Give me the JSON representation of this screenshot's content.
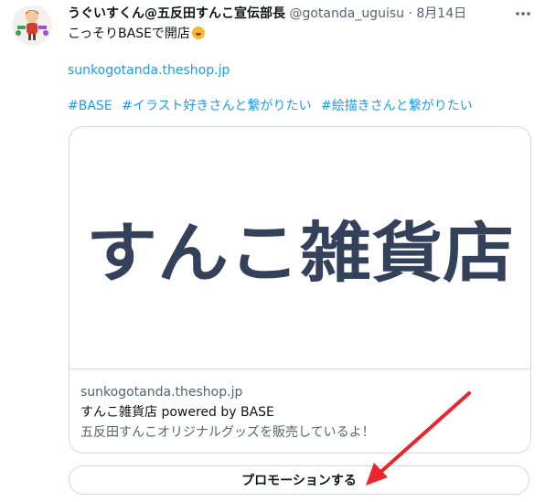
{
  "tweet": {
    "author_name": "うぐいすくん@五反田すんこ宣伝部長",
    "handle": "@gotanda_uguisu",
    "separator": "·",
    "date": "8月14日",
    "text": "こっそりBASEで開店",
    "link": "sunkogotanda.theshop.jp",
    "hashtags": [
      "#BASE",
      "#イラスト好きさんと繋がりたい",
      "#絵描きさんと繋がりたい"
    ]
  },
  "card": {
    "logo_text": "すんこ雑貨店",
    "domain": "sunkogotanda.theshop.jp",
    "title": "すんこ雑貨店 powered by BASE",
    "description": "五反田すんこオリジナルグッズを販売しているよ！"
  },
  "promote_label": "プロモーションする",
  "colors": {
    "link": "#1d9bf0",
    "secondary_text": "#536471",
    "border": "#cfd9de",
    "logo": "#34415a",
    "arrow": "#e8262b"
  }
}
